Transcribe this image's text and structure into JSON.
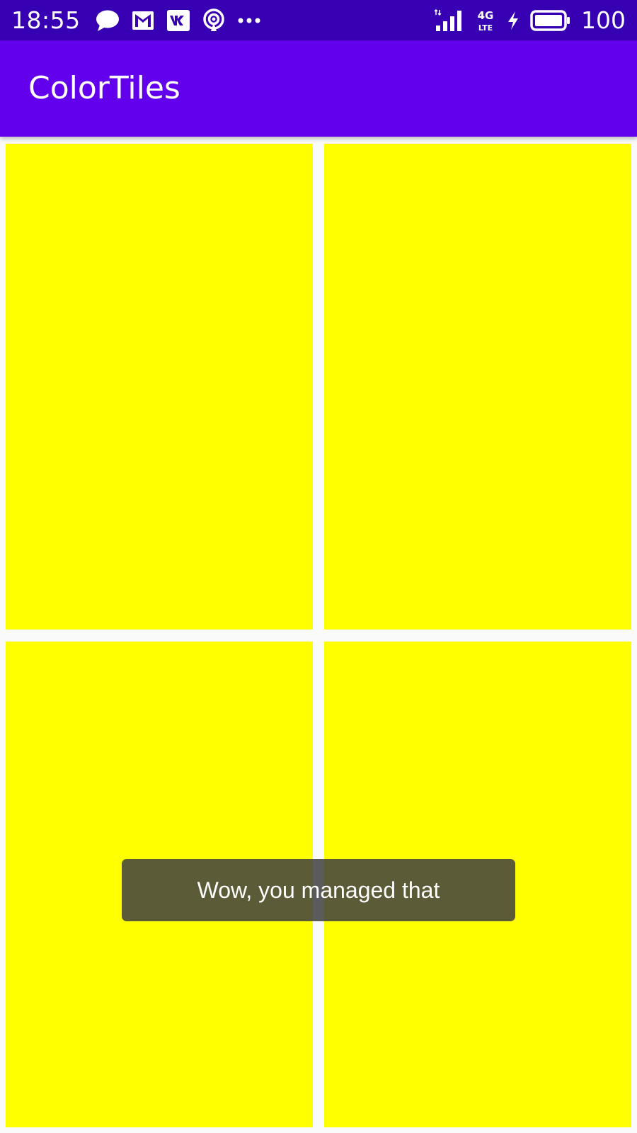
{
  "status_bar": {
    "time": "18:55",
    "notification_icons": [
      "chat-bubble-icon",
      "gmail-icon",
      "vk-icon",
      "broadcast-icon",
      "more-icon"
    ],
    "network_type": "4G LTE",
    "battery_level": "100"
  },
  "app_bar": {
    "title": "ColorTiles"
  },
  "tiles": [
    {
      "color": "#ffff00"
    },
    {
      "color": "#ffff00"
    },
    {
      "color": "#ffff00"
    },
    {
      "color": "#ffff00"
    }
  ],
  "toast": {
    "message": "Wow, you managed that"
  },
  "colors": {
    "status_bar": "#3700b3",
    "app_bar": "#6200ee",
    "tile": "#ffff00",
    "background": "#fafafa"
  }
}
